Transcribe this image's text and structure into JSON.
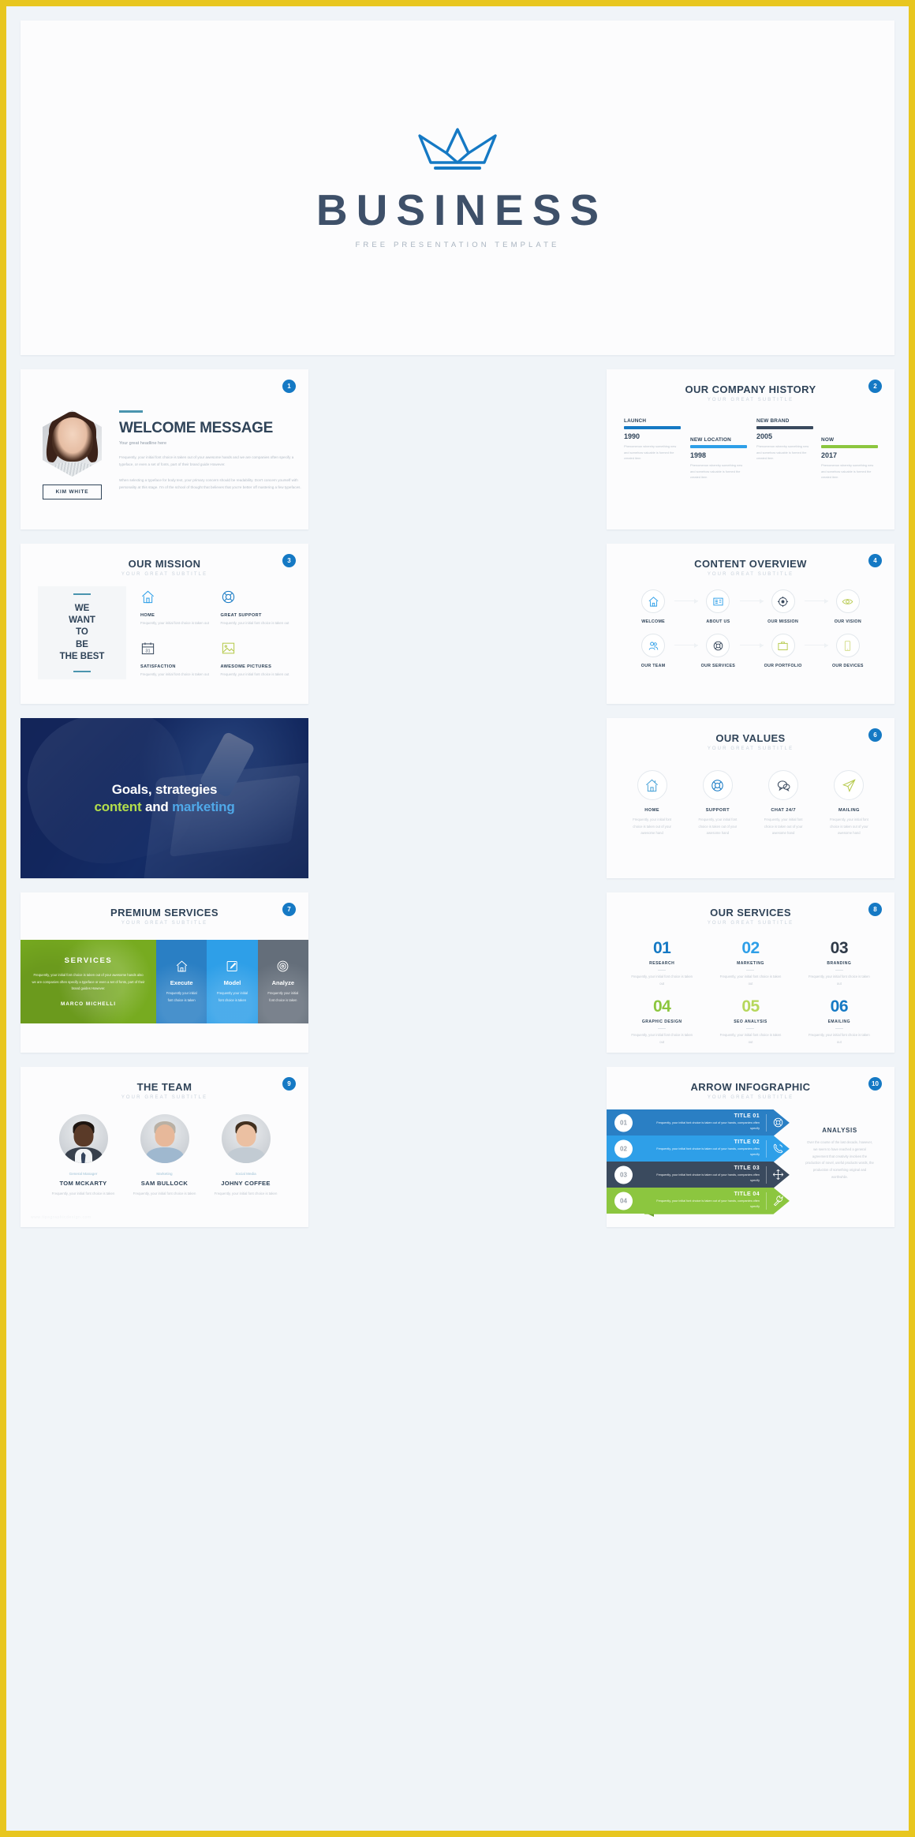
{
  "theme": {
    "border": "#e8c61f",
    "page_bg": "#f0f4f8",
    "slide_bg": "#fcfcfd",
    "brand_blue": "#1579c4",
    "light_blue": "#2e9fe8",
    "navy": "#2f4358",
    "green": "#8cc63f",
    "teal": "#4a94ae"
  },
  "hero": {
    "logo_icon": "crown-icon",
    "title": "BUSINESS",
    "subtitle": "FREE PRESENTATION TEMPLATE"
  },
  "common": {
    "subtitle": "YOUR GREAT SUBTITLE"
  },
  "slides": [
    {
      "number": "1",
      "name": "welcome-message",
      "title": "WELCOME MESSAGE",
      "headline": "Your great headline here",
      "person": "KIM WHITE",
      "paragraphs": [
        "Frequently, your initial font choice is taken out of your awesome hands and we are companies often specify a typeface, or even a set of fonts, part of their brand guide However.",
        "When selecting a typeface for body text, your primary concern should be readability. Don't concern yourself with personality at this stage. I'm of the school of thought that believes that you're better off mastering a few typefaces."
      ]
    },
    {
      "number": "2",
      "name": "our-company-history",
      "title": "OUR COMPANY HISTORY",
      "subtitle": "YOUR GREAT SUBTITLE",
      "milestones": [
        {
          "label": "LAUNCH",
          "year": "1990",
          "color": "#1579c4",
          "text": "Phenomenon whereby something new and somehow valuable is formed the created item"
        },
        {
          "label": "NEW LOCATION",
          "year": "1998",
          "color": "#2e9fe8",
          "text": "Phenomenon whereby something new and somehow valuable is formed the created item"
        },
        {
          "label": "NEW BRAND",
          "year": "2005",
          "color": "#3a4a5e",
          "text": "Phenomenon whereby something new and somehow valuable is formed the created item"
        },
        {
          "label": "NOW",
          "year": "2017",
          "color": "#8cc63f",
          "text": "Phenomenon whereby something new and somehow valuable is formed the created item"
        }
      ]
    },
    {
      "number": "3",
      "name": "our-mission",
      "title": "OUR MISSION",
      "subtitle": "YOUR GREAT SUBTITLE",
      "statement": "WE\nWANT\nTO\nBE\nTHE BEST",
      "features": [
        {
          "icon": "home-icon",
          "label": "HOME",
          "color": "#2e9fe8",
          "text": "Frequently, your initial font choice is taken out"
        },
        {
          "icon": "lifebuoy-icon",
          "label": "GREAT SUPPORT",
          "color": "#1579c4",
          "text": "Frequently, your initial font choice is taken out"
        },
        {
          "icon": "calendar-icon",
          "label": "SATISFACTION",
          "color": "#3a4a5e",
          "text": "Frequently, your initial font choice is taken out"
        },
        {
          "icon": "image-icon",
          "label": "AWESOME PICTURES",
          "color": "#b5c94a",
          "text": "Frequently, your initial font choice is taken out"
        }
      ]
    },
    {
      "number": "4",
      "name": "content-overview",
      "title": "CONTENT OVERVIEW",
      "subtitle": "YOUR GREAT SUBTITLE",
      "items": [
        {
          "icon": "home-icon",
          "label": "WELCOME",
          "color": "#2e9fe8",
          "arrow": true
        },
        {
          "icon": "news-icon",
          "label": "ABOUT US",
          "color": "#2e9fe8",
          "arrow": true
        },
        {
          "icon": "target-icon",
          "label": "OUR MISSION",
          "color": "#3a4a5e",
          "arrow": true
        },
        {
          "icon": "eye-icon",
          "label": "OUR VISION",
          "color": "#b5c94a",
          "arrow": false
        },
        {
          "icon": "team-icon",
          "label": "OUR TEAM",
          "color": "#2e9fe8",
          "arrow": true
        },
        {
          "icon": "lifebuoy-icon",
          "label": "OUR SERVICES",
          "color": "#3a4a5e",
          "arrow": true
        },
        {
          "icon": "briefcase-icon",
          "label": "OUR PORTFOLIO",
          "color": "#b5c94a",
          "arrow": true
        },
        {
          "icon": "phone-icon",
          "label": "OUR DEVICES",
          "color": "#d4dd8a",
          "arrow": false
        }
      ]
    },
    {
      "number": "",
      "name": "goals-strategies",
      "line1": "Goals, strategies",
      "line2_a": "content",
      "line2_b": " and ",
      "line2_c": "marketing"
    },
    {
      "number": "6",
      "name": "our-values",
      "title": "OUR VALUES",
      "subtitle": "YOUR GREAT SUBTITLE",
      "values": [
        {
          "icon": "home-icon",
          "label": "HOME",
          "color": "#4aa3d8",
          "text": "Frequently, your initial font choice is taken out of your awesome hand"
        },
        {
          "icon": "lifebuoy-icon",
          "label": "SUPPORT",
          "color": "#1579c4",
          "text": "Frequently, your initial font choice is taken out of your awesome hand"
        },
        {
          "icon": "chat-icon",
          "label": "CHAT 24/7",
          "color": "#3a4a5e",
          "text": "Frequently, your initial font choice is taken out of your awesome hand"
        },
        {
          "icon": "send-icon",
          "label": "MAILING",
          "color": "#b5c94a",
          "text": "Frequently, your initial font choice is taken out of your awesome hand"
        }
      ]
    },
    {
      "number": "7",
      "name": "premium-services",
      "title": "PREMIUM SERVICES",
      "subtitle": "YOUR GREAT SUBTITLE",
      "panel": {
        "heading": "SERVICES",
        "text": "Frequently, your initial font choice is taken out of your awesome hands also we are companies often specify a typeface or even a set of fonts, part of their brand guides However.",
        "author": "MARCO MICHELLI",
        "color": "#77ab20"
      },
      "columns": [
        {
          "icon": "home-icon",
          "label": "Execute",
          "text": "Frequently your initial font choice is taken",
          "color": "#2a7fc4"
        },
        {
          "icon": "edit-icon",
          "label": "Model",
          "text": "Frequently your initial font choice is taken",
          "color": "#2e9fe8"
        },
        {
          "icon": "target-icon",
          "label": "Analyze",
          "text": "Frequently your initial font choice is taken",
          "color": "#646e7a"
        }
      ]
    },
    {
      "number": "8",
      "name": "our-services",
      "title": "OUR SERVICES",
      "subtitle": "YOUR GREAT SUBTITLE",
      "services": [
        {
          "num": "01",
          "label": "RESEARCH",
          "color": "#1579c4",
          "text": "Frequently, your initial font choice is taken out"
        },
        {
          "num": "02",
          "label": "MARKETING",
          "color": "#2e9fe8",
          "text": "Frequently, your initial font choice is taken out"
        },
        {
          "num": "03",
          "label": "BRANDING",
          "color": "#2f3a48",
          "text": "Frequently, your initial font choice is taken out"
        },
        {
          "num": "04",
          "label": "GRAPHIC DESIGN",
          "color": "#8cc63f",
          "text": "Frequently, your initial font choice is taken out"
        },
        {
          "num": "05",
          "label": "SEO ANALYSIS",
          "color": "#b6d75c",
          "text": "Frequently, your initial font choice is taken out"
        },
        {
          "num": "06",
          "label": "EMAILING",
          "color": "#1579c4",
          "text": "Frequently, your initial font choice is taken out"
        }
      ]
    },
    {
      "number": "9",
      "name": "the-team",
      "title": "THE TEAM",
      "subtitle": "YOUR GREAT SUBTITLE",
      "members": [
        {
          "role": "General Manager",
          "name": "TOM MCKARTY",
          "text": "Frequently, your initial font choice is taken",
          "skin": "#5a3a28",
          "hair": "#1e1510",
          "torso": "#38404c",
          "tie": true
        },
        {
          "role": "Marketing",
          "name": "SAM BULLOCK",
          "text": "Frequently, your initial font choice is taken",
          "skin": "#e7b89a",
          "hair": "#b9b0a4",
          "torso": "#9fb8cf",
          "tie": false
        },
        {
          "role": "Social Media",
          "name": "JOHNY COFFEE",
          "text": "Frequently, your initial font choice is taken",
          "skin": "#ebc0a2",
          "hair": "#42301f",
          "torso": "#c2cbd3",
          "tie": false
        }
      ],
      "watermark": "www.tipsgraphicdesign.com"
    },
    {
      "number": "10",
      "name": "arrow-infographic",
      "title": "ARROW INFOGRAPHIC",
      "subtitle": "YOUR GREAT SUBTITLE",
      "rows": [
        {
          "num": "01",
          "title": "TITLE 01",
          "icon": "lifebuoy-icon",
          "text": "Frequently, your initial font choice is taken out of your hands, companies often specify",
          "color": "#2a7fc4",
          "shade": "#1b5f96"
        },
        {
          "num": "02",
          "title": "TITLE 02",
          "icon": "call-icon",
          "text": "Frequently, your initial font choice is taken out of your hands, companies often specify",
          "color": "#2e9fe8",
          "shade": "#1f78b4"
        },
        {
          "num": "03",
          "title": "TITLE 03",
          "icon": "move-icon",
          "text": "Frequently, your initial font choice is taken out of your hands, companies often specify",
          "color": "#3a4a5e",
          "shade": "#2a3646"
        },
        {
          "num": "04",
          "title": "TITLE 04",
          "icon": "wrench-icon",
          "text": "Frequently, your initial font choice is taken out of your hands, companies often specify",
          "color": "#8cc63f",
          "shade": "#6ca02e"
        }
      ],
      "analysis_title": "ANALYSIS",
      "analysis_text": "Over the course of the last decade, however, we seem to have reached a general agreement that creativity involves the production of novel, useful products words, the production of something original and worthwhile."
    }
  ]
}
